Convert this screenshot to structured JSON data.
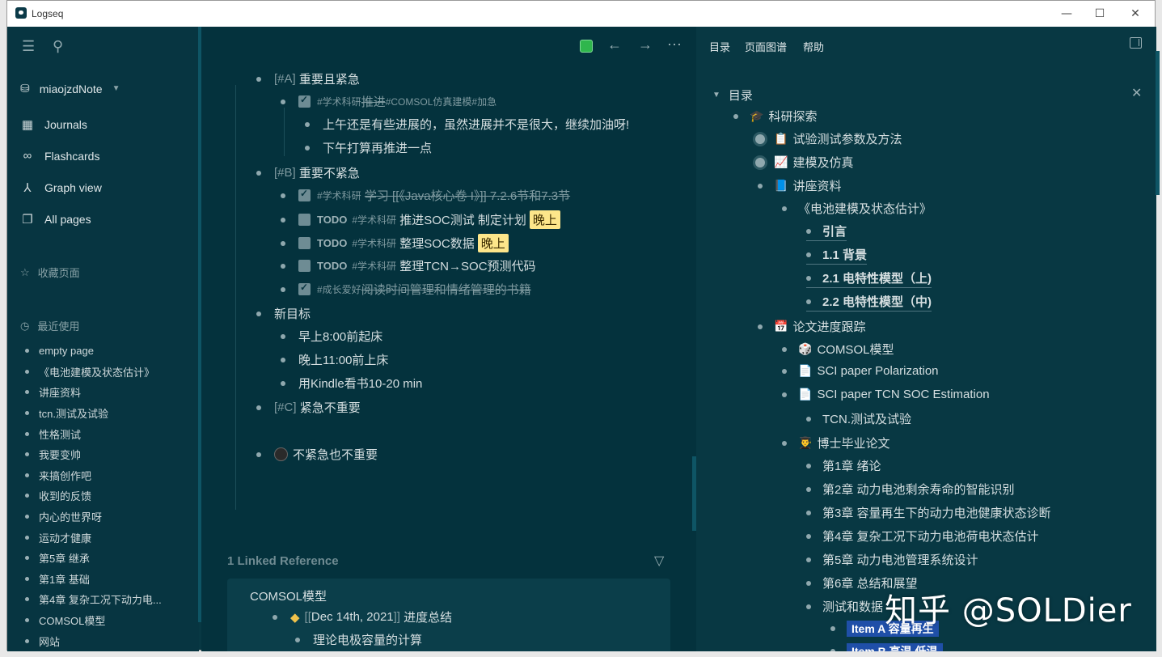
{
  "window": {
    "title": "Logseq",
    "min": "—",
    "max": "☐",
    "close": "✕"
  },
  "sidebar": {
    "graph_name": "miaojzdNote",
    "nav": [
      {
        "label": "Journals",
        "icon": "calendar-icon"
      },
      {
        "label": "Flashcards",
        "icon": "infinity-icon"
      },
      {
        "label": "Graph view",
        "icon": "graph-icon"
      },
      {
        "label": "All pages",
        "icon": "pages-icon"
      }
    ],
    "favorites_title": "收藏页面",
    "recent_title": "最近使用",
    "recent": [
      "empty page",
      "《电池建模及状态估计》",
      "讲座资料",
      "tcn.测试及试验",
      "性格测试",
      "我要变帅",
      "来搞创作吧",
      "收到的反馈",
      "内心的世界呀",
      "运动才健康",
      "第5章 继承",
      "第1章 基础",
      "第4章 复杂工况下动力电...",
      "COMSOL模型",
      "网站"
    ]
  },
  "main": {
    "blocks": {
      "a_prefix": "[#A]",
      "a_text": "重要且紧急",
      "a1_tag": "#学术科研",
      "a1_text": "推进",
      "a1_tag2": "#COMSOL仿真建模",
      "a1_tag3": "#加急",
      "a1_c1": "上午还是有些进展的，虽然进展并不是很大，继续加油呀!",
      "a1_c2": "下午打算再推进一点",
      "b_prefix": "[#B]",
      "b_text": "重要不紧急",
      "b1_tag": "#学术科研",
      "b1_text": "学习 [[《Java核心卷 I》]] 7.2.6节和7.3节",
      "b2_todo": "TODO",
      "b2_tag": "#学术科研",
      "b2_text": "推进SOC测试 制定计划",
      "b2_hl": "晚上",
      "b3_todo": "TODO",
      "b3_tag": "#学术科研",
      "b3_text": "整理SOC数据",
      "b3_hl": "晚上",
      "b4_todo": "TODO",
      "b4_tag": "#学术科研",
      "b4_text": "整理TCN→SOC预测代码",
      "b5_tag": "#成长爱好",
      "b5_text": "阅读时间管理和情绪管理的书籍",
      "new_goal": "新目标",
      "g1": "早上8:00前起床",
      "g2": "晚上11:00前上床",
      "g3": "用Kindle看书10-20 min",
      "c_prefix": "[#C]",
      "c_text": "紧急不重要",
      "d_text": "不紧急也不重要"
    },
    "linked_ref_title": "1 Linked Reference",
    "ref_page": "COMSOL模型",
    "ref_date": "Dec 14th, 2021",
    "ref_date_suffix": "进度总结",
    "ref_child": "理论电极容量的计算"
  },
  "right": {
    "tabs": [
      "目录",
      "页面图谱",
      "帮助"
    ],
    "toc_title": "目录",
    "items": {
      "r1": "科研探索",
      "r2": "试验测试参数及方法",
      "r3": "建模及仿真",
      "r4": "讲座资料",
      "r5": "《电池建模及状态估计》",
      "r6": "引言",
      "r7": "1.1 背景",
      "r8": "2.1 电特性模型（上)",
      "r9": "2.2 电特性模型（中)",
      "r10": "论文进度跟踪",
      "r11": "COMSOL模型",
      "r12": "SCI paper Polarization",
      "r13": "SCI paper TCN SOC Estimation",
      "r14": "TCN.测试及试验",
      "r15": "博士毕业论文",
      "r16": "第1章 绪论",
      "r17": "第2章 动力电池剩余寿命的智能识别",
      "r18": "第3章 容量再生下的动力电池健康状态诊断",
      "r19": "第4章 复杂工况下动力电池荷电状态估计",
      "r20": "第5章 动力电池管理系统设计",
      "r21": "第6章 总结和展望",
      "r22": "测试和数据",
      "r23": "Item A 容量再生",
      "r24": "Item B 高温 低温"
    }
  },
  "watermark": "知乎 @SOLDier"
}
